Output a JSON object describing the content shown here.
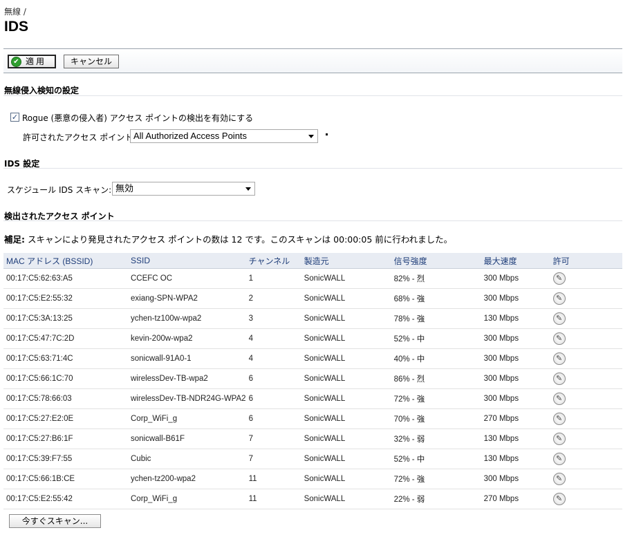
{
  "breadcrumb": "無線 /",
  "title": "IDS",
  "toolbar": {
    "apply_label": "適用",
    "cancel_label": "キャンセル"
  },
  "section1": {
    "title": "無線侵入検知の設定",
    "rogue_checkbox_label": "Rogue (悪意の侵入者) アクセス ポイントの検出を有効にする",
    "rogue_checked": true,
    "allowed_ap_label": "許可されたアクセス ポイント:",
    "allowed_ap_value": "All Authorized Access Points"
  },
  "section2": {
    "title": "IDS 設定",
    "schedule_label": "スケジュール IDS スキャン:",
    "schedule_value": "無効"
  },
  "section3": {
    "title": "検出されたアクセス ポイント",
    "note_prefix": "補足:",
    "note_text": "スキャンにより発見されたアクセス ポイントの数は 12 です。このスキャンは 00:00:05 前に行われました。"
  },
  "table": {
    "headers": [
      "MAC アドレス (BSSID)",
      "SSID",
      "チャンネル",
      "製造元",
      "信号強度",
      "最大速度",
      "許可"
    ],
    "rows": [
      {
        "mac": "00:17:C5:62:63:A5",
        "ssid": "CCEFC OC",
        "channel": "1",
        "vendor": "SonicWALL",
        "signal": "82% - 烈",
        "speed": "300 Mbps"
      },
      {
        "mac": "00:17:C5:E2:55:32",
        "ssid": "exiang-SPN-WPA2",
        "channel": "2",
        "vendor": "SonicWALL",
        "signal": "68% - 強",
        "speed": "300 Mbps"
      },
      {
        "mac": "00:17:C5:3A:13:25",
        "ssid": "ychen-tz100w-wpa2",
        "channel": "3",
        "vendor": "SonicWALL",
        "signal": "78% - 強",
        "speed": "130 Mbps"
      },
      {
        "mac": "00:17:C5:47:7C:2D",
        "ssid": "kevin-200w-wpa2",
        "channel": "4",
        "vendor": "SonicWALL",
        "signal": "52% - 中",
        "speed": "300 Mbps"
      },
      {
        "mac": "00:17:C5:63:71:4C",
        "ssid": "sonicwall-91A0-1",
        "channel": "4",
        "vendor": "SonicWALL",
        "signal": "40% - 中",
        "speed": "300 Mbps"
      },
      {
        "mac": "00:17:C5:66:1C:70",
        "ssid": "wirelessDev-TB-wpa2",
        "channel": "6",
        "vendor": "SonicWALL",
        "signal": "86% - 烈",
        "speed": "300 Mbps"
      },
      {
        "mac": "00:17:C5:78:66:03",
        "ssid": "wirelessDev-TB-NDR24G-WPA2",
        "channel": "6",
        "vendor": "SonicWALL",
        "signal": "72% - 強",
        "speed": "300 Mbps"
      },
      {
        "mac": "00:17:C5:27:E2:0E",
        "ssid": "Corp_WiFi_g",
        "channel": "6",
        "vendor": "SonicWALL",
        "signal": "70% - 強",
        "speed": "270 Mbps"
      },
      {
        "mac": "00:17:C5:27:B6:1F",
        "ssid": "sonicwall-B61F",
        "channel": "7",
        "vendor": "SonicWALL",
        "signal": "32% - 弱",
        "speed": "130 Mbps"
      },
      {
        "mac": "00:17:C5:39:F7:55",
        "ssid": "Cubic",
        "channel": "7",
        "vendor": "SonicWALL",
        "signal": "52% - 中",
        "speed": "130 Mbps"
      },
      {
        "mac": "00:17:C5:66:1B:CE",
        "ssid": "ychen-tz200-wpa2",
        "channel": "11",
        "vendor": "SonicWALL",
        "signal": "72% - 強",
        "speed": "300 Mbps"
      },
      {
        "mac": "00:17:C5:E2:55:42",
        "ssid": "Corp_WiFi_g",
        "channel": "11",
        "vendor": "SonicWALL",
        "signal": "22% - 弱",
        "speed": "270 Mbps"
      }
    ]
  },
  "scan_button_label": "今すぐスキャン..."
}
